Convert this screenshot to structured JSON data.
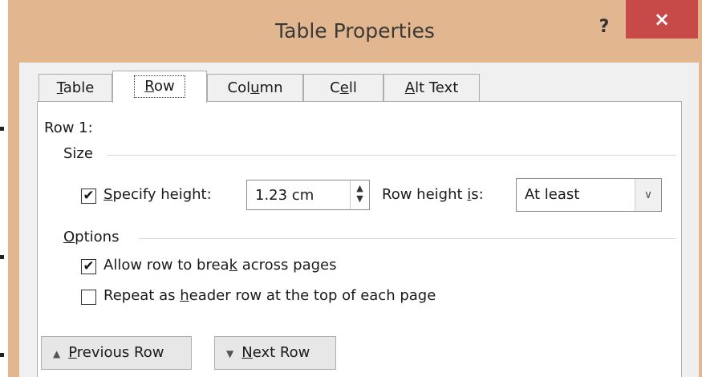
{
  "window": {
    "title": "Table Properties",
    "help_label": "?",
    "close_label": "×"
  },
  "tabs": [
    {
      "pre": "",
      "ul": "T",
      "post": "able"
    },
    {
      "pre": "",
      "ul": "R",
      "post": "ow"
    },
    {
      "pre": "Col",
      "ul": "u",
      "post": "mn"
    },
    {
      "pre": "C",
      "ul": "e",
      "post": "ll"
    },
    {
      "pre": "",
      "ul": "A",
      "post": "lt Text"
    }
  ],
  "active_tab_index": 1,
  "row_label": "Row 1:",
  "size_group": {
    "label": "Size",
    "specify_height": {
      "checked": true,
      "pre": "",
      "ul": "S",
      "post": "pecify height:"
    },
    "height_value": "1.23 cm",
    "row_height_is": {
      "pre": "Row height ",
      "ul": "i",
      "post": "s:"
    },
    "row_height_mode": "At least"
  },
  "options_group": {
    "pre": "",
    "ul": "O",
    "post": "ptions",
    "allow_break": {
      "checked": true,
      "pre": "Allow row to brea",
      "ul": "k",
      "post": " across pages"
    },
    "repeat_header": {
      "checked": false,
      "pre": "Repeat as ",
      "ul": "h",
      "post": "eader row at the top of each page"
    }
  },
  "nav": {
    "previous": {
      "pre": "",
      "ul": "P",
      "post": "revious Row"
    },
    "next": {
      "pre": "",
      "ul": "N",
      "post": "ext Row"
    }
  },
  "glyphs": {
    "check": "✔",
    "spin_up": "▲",
    "spin_down": "▼",
    "dropdown": "∨",
    "prev_arrow": "▲",
    "next_arrow": "▼"
  }
}
